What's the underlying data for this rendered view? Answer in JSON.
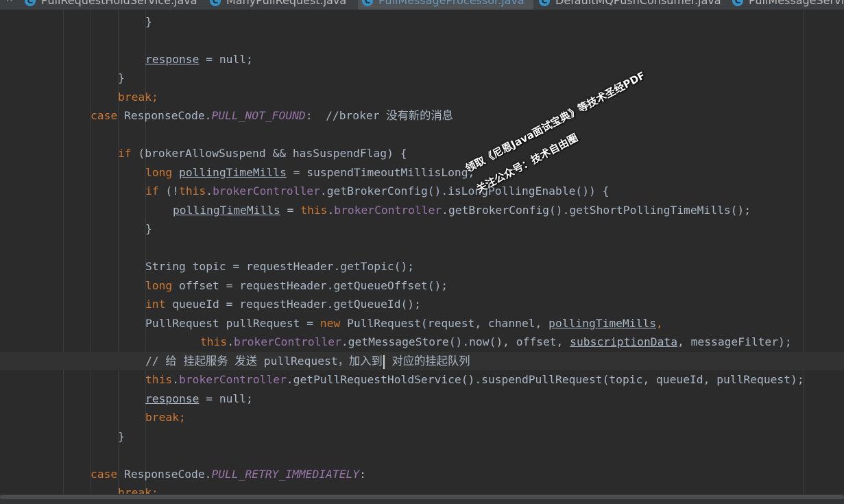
{
  "tabs": [
    {
      "label": "PullRequestHoldService.java",
      "active": false,
      "icon": "class-icon"
    },
    {
      "label": "ManyPullRequest.java",
      "active": false,
      "icon": "class-icon"
    },
    {
      "label": "PullMessageProcessor.java",
      "active": true,
      "icon": "class-icon"
    },
    {
      "label": "DefaultMQPushConsumer.java",
      "active": false,
      "icon": "class-icon"
    },
    {
      "label": "PullMessageServic",
      "active": false,
      "icon": "class-icon"
    }
  ],
  "code": {
    "l1": "}",
    "l2_var": "response",
    "l2_rest": " = null;",
    "l3": "}",
    "l4": "break;",
    "l5_case": "case",
    "l5_cls": " ResponseCode.",
    "l5_const": "PULL_NOT_FOUND",
    "l5_rest": ":  //broker 没有新的消息",
    "l6_kw": "if",
    "l6_rest": " (brokerAllowSuspend && hasSuspendFlag) {",
    "l7_kw": "long",
    "l7_var": "pollingTimeMills",
    "l7_rest": " = suspendTimeoutMillisLong;",
    "l8_kw": "if",
    "l8_a": " (!",
    "l8_this": "this",
    "l8_dot": ".",
    "l8_fld": "brokerController",
    "l8_rest": ".getBrokerConfig().isLongPollingEnable()) {",
    "l9_var": "pollingTimeMills",
    "l9_eq": " = ",
    "l9_this": "this",
    "l9_dot": ".",
    "l9_fld": "brokerController",
    "l9_rest": ".getBrokerConfig().getShortPollingTimeMills();",
    "l10": "}",
    "l11": "String topic = requestHeader.getTopic();",
    "l12_kw": "long",
    "l12_rest": " offset = requestHeader.getQueueOffset();",
    "l13_kw": "int",
    "l13_rest": " queueId = requestHeader.getQueueId();",
    "l14_a": "PullRequest pullRequest = ",
    "l14_new": "new",
    "l14_b": " PullRequest(request, channel, ",
    "l14_var": "pollingTimeMills",
    "l14_c": ",",
    "l15_this": "this",
    "l15_dot": ".",
    "l15_fld": "brokerController",
    "l15_a": ".getMessageStore().now(), offset, ",
    "l15_var": "subscriptionData",
    "l15_b": ", messageFilter);",
    "l16_a": "// 给 挂起服务 发送 pullRequest，加入到",
    "l16_b": " 对应的挂起队列",
    "l17_this": "this",
    "l17_dot": ".",
    "l17_fld": "brokerController",
    "l17_rest": ".getPullRequestHoldService().suspendPullRequest(topic, queueId, pullRequest);",
    "l18_var": "response",
    "l18_rest": " = null;",
    "l19": "break;",
    "l20": "}",
    "l21_case": "case",
    "l21_cls": " ResponseCode.",
    "l21_const": "PULL_RETRY_IMMEDIATELY",
    "l21_rest": ":",
    "l22": "break;"
  },
  "watermark": {
    "line1": "领取《尼恩Java面试宝典》等技术圣经PDF",
    "line2": "关注公众号：技术自由圈"
  },
  "colors": {
    "background": "#2b2b2b",
    "keyword": "#cc7832",
    "field": "#9876aa",
    "text": "#a9b7c6",
    "active_tab_text": "#6897bb"
  }
}
